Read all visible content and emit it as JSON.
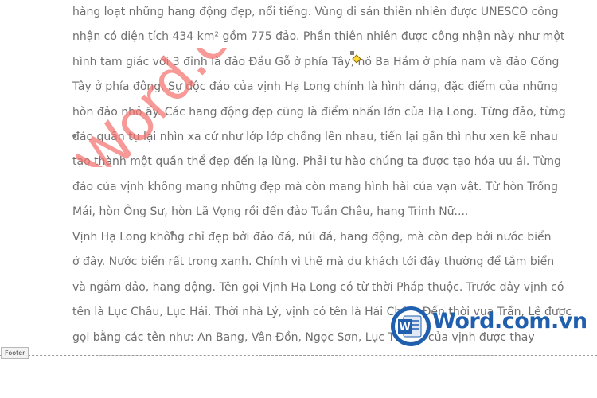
{
  "document": {
    "paragraph1": [
      "hàng loạt những hang động đẹp, nổi tiếng. Vùng di sản thiên nhiên được UNESCO công",
      "nhận có diện tích 434 km² gồm 775 đảo. Phần thiên nhiên được công nhận này như một",
      "hình tam giác với 3 đỉnh là đảo Đầu Gỗ ở phía Tây, hồ Ba Hầm ở phía nam và đảo Cống",
      "Tây ở phía đông. Sự độc đáo của vịnh Hạ Long chính là hình dáng, đặc điểm của những",
      "hòn đảo nhỏ ấy. Các hang động đẹp cũng là điểm nhấn lớn của Hạ Long. Từng đảo, từng",
      "đảo quần tụ lại nhìn xa cứ như lớp lớp chồng lên nhau, tiến lại gần thì như xen kẽ nhau",
      "tạo thành một quần thể đẹp đến lạ lùng. Phải tự hào chúng ta được tạo hóa ưu ái. Từng",
      "đảo của vịnh không mang những đẹp mà còn mang hình hài của vạn vật. Từ hòn Trống",
      "Mái, hòn Ông Sư, hòn Lã Vọng rồi đến đảo Tuần Châu, hang Trinh Nữ...."
    ],
    "paragraph2": [
      "Vịnh Hạ Long không chỉ đẹp bởi đảo đá, núi đá, hang động, mà còn đẹp bởi nước biển",
      "ở đây. Nước biển rất trong xanh. Chính vì thế mà du khách tới đây thường để tắm biển",
      "và ngắm đảo, hang động. Tên gọi Vịnh Hạ Long có từ thời Pháp thuộc. Trước đây vịnh có",
      "tên là Lục Châu, Lục Hải. Thời nhà Lý, vịnh có tên là Hải Châu. Đến thời vua Trần, Lê được",
      "gọi bằng các tên như: An Bang, Vân Đồn, Ngọc Sơn, Lục Thủy... của vịnh được thay"
    ]
  },
  "watermark": {
    "text": "Word.c",
    "color": "#f4736f"
  },
  "footer": {
    "label": "Footer"
  },
  "logo": {
    "name": "Word",
    "domain": ".com.vn",
    "icon_letter": "W",
    "brand_color": "#1f5fae"
  }
}
